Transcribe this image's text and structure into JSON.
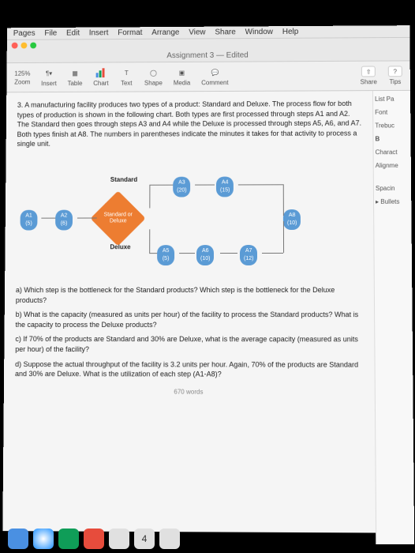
{
  "menubar": {
    "app": "Pages",
    "items": [
      "File",
      "Edit",
      "Insert",
      "Format",
      "Arrange",
      "View",
      "Share",
      "Window",
      "Help"
    ]
  },
  "window": {
    "title": "Assignment 3 — Edited"
  },
  "toolbar": {
    "zoom": "125%",
    "zoom_lbl": "Zoom",
    "insert": "Insert",
    "table": "Table",
    "chart": "Chart",
    "text": "Text",
    "shape": "Shape",
    "media": "Media",
    "comment": "Comment",
    "share": "Share",
    "tips": "Tips"
  },
  "doc": {
    "q3": "3. A manufacturing facility produces two types of a product: Standard and Deluxe. The process flow for both types of production is shown in the following chart. Both types are first processed through steps A1 and A2. The Standard then goes through steps A3 and A4 while the Deluxe is processed through steps A5, A6, and A7. Both types finish at A8. The numbers in parentheses indicate the minutes it takes for that activity to process a single unit.",
    "labels": {
      "standard": "Standard",
      "deluxe": "Deluxe",
      "decision": "Standard or Deluxe"
    },
    "nodes": {
      "A1": {
        "name": "A1",
        "time": "(5)"
      },
      "A2": {
        "name": "A2",
        "time": "(6)"
      },
      "A3": {
        "name": "A3",
        "time": "(20)"
      },
      "A4": {
        "name": "A4",
        "time": "(15)"
      },
      "A5": {
        "name": "A5",
        "time": "(5)"
      },
      "A6": {
        "name": "A6",
        "time": "(10)"
      },
      "A7": {
        "name": "A7",
        "time": "(12)"
      },
      "A8": {
        "name": "A8",
        "time": "(10)"
      }
    },
    "qa": "a) Which step is the bottleneck for the Standard products? Which step is the bottleneck for the Deluxe products?",
    "qb": "b) What is the capacity (measured as units per hour) of the facility to process the Standard products? What is the capacity to process the Deluxe products?",
    "qc": "c) If 70% of the products are Standard and 30% are Deluxe, what is the average capacity (measured as units per hour) of the facility?",
    "qd": "d) Suppose the actual throughput of the facility is 3.2 units per hour. Again, 70% of the products are Standard and 30% are Deluxe. What is the utilization of each step (A1-A8)?",
    "wordcount": "670 words"
  },
  "sidebar": {
    "listp": "List Pa",
    "font": "Font",
    "trebuchet": "Trebuc",
    "bold": "B",
    "character": "Charact",
    "alignment": "Alignme",
    "spacing": "Spacin",
    "bullets": "Bullets"
  },
  "chart_data": {
    "type": "flowchart",
    "nodes": [
      {
        "id": "A1",
        "label": "A1",
        "time": 5
      },
      {
        "id": "A2",
        "label": "A2",
        "time": 6
      },
      {
        "id": "D",
        "label": "Standard or Deluxe",
        "type": "decision"
      },
      {
        "id": "A3",
        "label": "A3",
        "time": 20
      },
      {
        "id": "A4",
        "label": "A4",
        "time": 15
      },
      {
        "id": "A5",
        "label": "A5",
        "time": 5
      },
      {
        "id": "A6",
        "label": "A6",
        "time": 10
      },
      {
        "id": "A7",
        "label": "A7",
        "time": 12
      },
      {
        "id": "A8",
        "label": "A8",
        "time": 10
      }
    ],
    "edges": [
      [
        "A1",
        "A2"
      ],
      [
        "A2",
        "D"
      ],
      [
        "D",
        "A3"
      ],
      [
        "A3",
        "A4"
      ],
      [
        "A4",
        "A8"
      ],
      [
        "D",
        "A5"
      ],
      [
        "A5",
        "A6"
      ],
      [
        "A6",
        "A7"
      ],
      [
        "A7",
        "A8"
      ]
    ],
    "branches": {
      "Standard": [
        "A3",
        "A4"
      ],
      "Deluxe": [
        "A5",
        "A6",
        "A7"
      ]
    }
  }
}
